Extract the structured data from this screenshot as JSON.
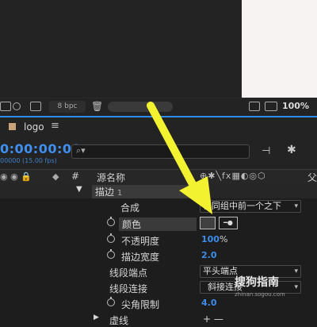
{
  "toolbar": {
    "bpc_label": "8 bpc",
    "zoom": "100%"
  },
  "panel": {
    "tab_title": "logo",
    "tab_menu": "≡"
  },
  "timeline": {
    "timecode": "0:00:00:00",
    "fps": "00000 (15.00 fps)",
    "search_icon": "⌕▾"
  },
  "columns": {
    "hash": "#",
    "source_name": "源名称",
    "partial_cut_right": "父"
  },
  "layer_group": {
    "name": "描边",
    "index": "1"
  },
  "properties": {
    "composite": {
      "label": "合成",
      "value": "在同组中前一个之下"
    },
    "color": {
      "label": "颜色",
      "eyedropper": "━●"
    },
    "opacity": {
      "label": "不透明度",
      "value": "100",
      "unit": "%"
    },
    "stroke_width": {
      "label": "描边宽度",
      "value": "2.0"
    },
    "line_cap": {
      "label": "线段端点",
      "value": "平头端点"
    },
    "line_join": {
      "label": "线段连接",
      "value": "斜接连接"
    },
    "miter_limit": {
      "label": "尖角限制",
      "value": "4.0"
    },
    "dash": {
      "label": "虚线",
      "add": "+ —"
    }
  },
  "watermark": {
    "text": "搜狗指南",
    "url": "zhinan.sogou.com"
  },
  "colors": {
    "accent_blue": "#2d8ceb",
    "annotation_arrow": "#f2f230",
    "canvas": "#f8f3f3"
  }
}
